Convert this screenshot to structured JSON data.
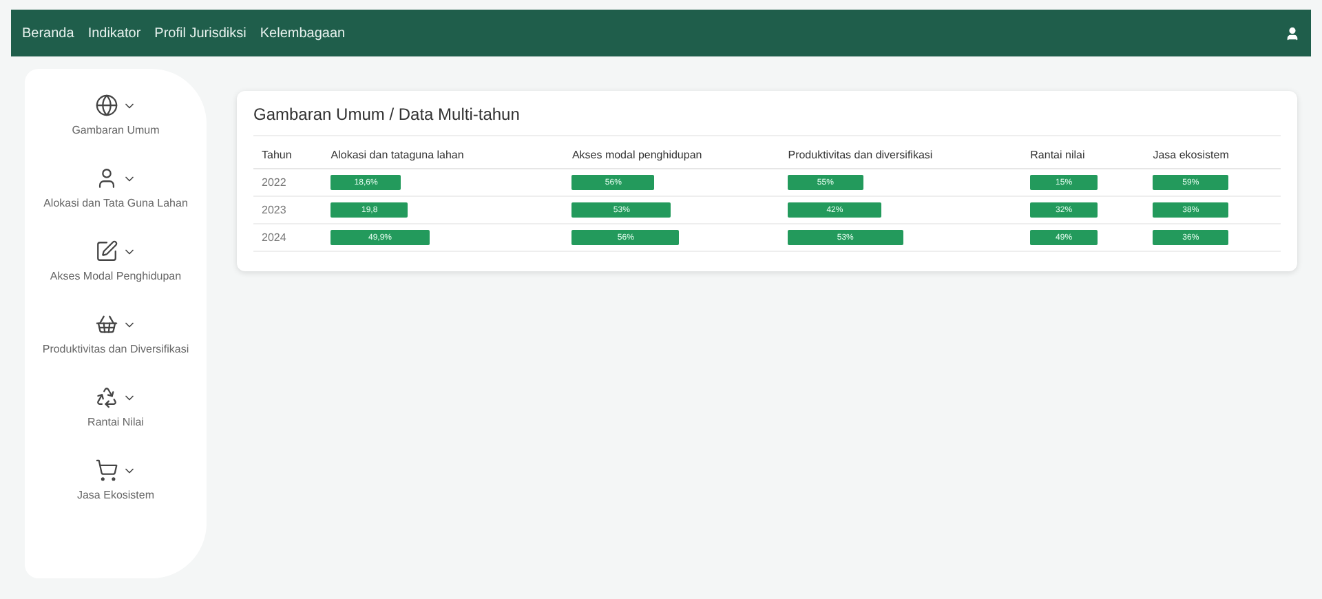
{
  "nav": {
    "links": [
      "Beranda",
      "Indikator",
      "Profil Jurisdiksi",
      "Kelembagaan"
    ]
  },
  "sidebar": {
    "items": [
      {
        "label": "Gambaran Umum"
      },
      {
        "label": "Alokasi dan Tata Guna Lahan"
      },
      {
        "label": "Akses Modal Penghidupan"
      },
      {
        "label": "Produktivitas dan Diversifikasi"
      },
      {
        "label": "Rantai Nilai"
      },
      {
        "label": "Jasa Ekosistem"
      }
    ]
  },
  "card": {
    "title": "Gambaran Umum / Data Multi-tahun",
    "table": {
      "columns": [
        "Tahun",
        "Alokasi dan tataguna lahan",
        "Akses modal penghidupan",
        "Produktivitas dan diversifikasi",
        "Rantai nilai",
        "Jasa ekosistem"
      ],
      "rows": [
        {
          "cells": [
            {
              "kind": "text",
              "text": "2022"
            },
            {
              "kind": "bar",
              "text": "18,6%",
              "level": 0.3
            },
            {
              "kind": "bar",
              "text": "56%",
              "level": 0.4
            },
            {
              "kind": "bar",
              "text": "55%",
              "level": 0.32
            },
            {
              "kind": "bar",
              "text": "15%",
              "level": 0.61
            },
            {
              "kind": "bar",
              "text": "59%",
              "level": 0.61
            }
          ]
        },
        {
          "cells": [
            {
              "kind": "text",
              "text": "2023"
            },
            {
              "kind": "bar",
              "text": "19,8",
              "level": 0.33
            },
            {
              "kind": "bar",
              "text": "53%",
              "level": 0.48
            },
            {
              "kind": "bar",
              "text": "42%",
              "level": 0.4
            },
            {
              "kind": "bar",
              "text": "32%",
              "level": 0.61
            },
            {
              "kind": "bar",
              "text": "38%",
              "level": 0.61
            }
          ]
        },
        {
          "cells": [
            {
              "kind": "text",
              "text": "2024"
            },
            {
              "kind": "bar",
              "text": "49,9%",
              "level": 0.42
            },
            {
              "kind": "bar",
              "text": "56%",
              "level": 0.52
            },
            {
              "kind": "bar",
              "text": "53%",
              "level": 0.49
            },
            {
              "kind": "bar",
              "text": "49%",
              "level": 0.61
            },
            {
              "kind": "bar",
              "text": "36%",
              "level": 0.61
            }
          ]
        }
      ]
    }
  }
}
